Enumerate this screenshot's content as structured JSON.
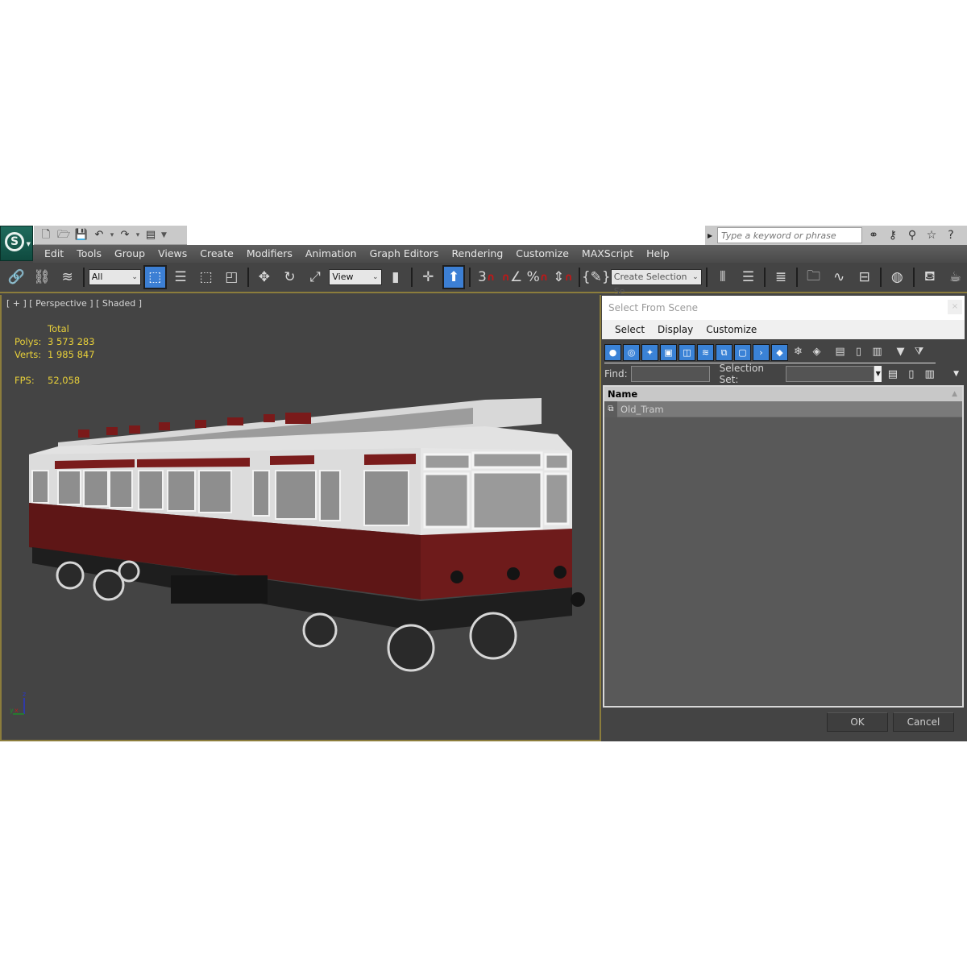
{
  "quick_access": {
    "icons": [
      "new-file-icon",
      "open-folder-icon",
      "save-icon",
      "undo-icon",
      "redo-icon",
      "project-folder-icon",
      "customize-caret-icon"
    ]
  },
  "search": {
    "placeholder": "Type a keyword or phrase",
    "icons": [
      "binoculars-icon",
      "key-icon",
      "satellite-icon",
      "star-icon",
      "help-icon"
    ]
  },
  "menubar": {
    "items": [
      "Edit",
      "Tools",
      "Group",
      "Views",
      "Create",
      "Modifiers",
      "Animation",
      "Graph Editors",
      "Rendering",
      "Customize",
      "MAXScript",
      "Help"
    ]
  },
  "toolbar": {
    "selection_filter": "All",
    "reference_coord": "View",
    "named_selection_placeholder": "Create Selection Se",
    "snap_3d_label": "3",
    "percent_label": "%"
  },
  "viewport": {
    "label": "[ + ] [ Perspective ] [ Shaded ]",
    "stats": {
      "header": "Total",
      "polys_label": "Polys:",
      "polys_value": "3 573 283",
      "verts_label": "Verts:",
      "verts_value": "1 985 847",
      "fps_label": "FPS:",
      "fps_value": "52,058"
    },
    "axis": {
      "x": "x",
      "y": "y",
      "z": "z"
    },
    "colors": {
      "border": "#8c7d3c",
      "stats": "#e8d03a",
      "tram_body": "#6b1a1a",
      "tram_upper": "#e4e4e4"
    }
  },
  "dialog": {
    "title": "Select From Scene",
    "close": "×",
    "menu": [
      "Select",
      "Display",
      "Customize"
    ],
    "find_label": "Find:",
    "find_value": "",
    "selection_set_label": "Selection Set:",
    "selection_set_value": "",
    "column_header": "Name",
    "rows": [
      {
        "name": "Old_Tram"
      }
    ],
    "ok_label": "OK",
    "cancel_label": "Cancel",
    "accent": "#3a82d6"
  }
}
